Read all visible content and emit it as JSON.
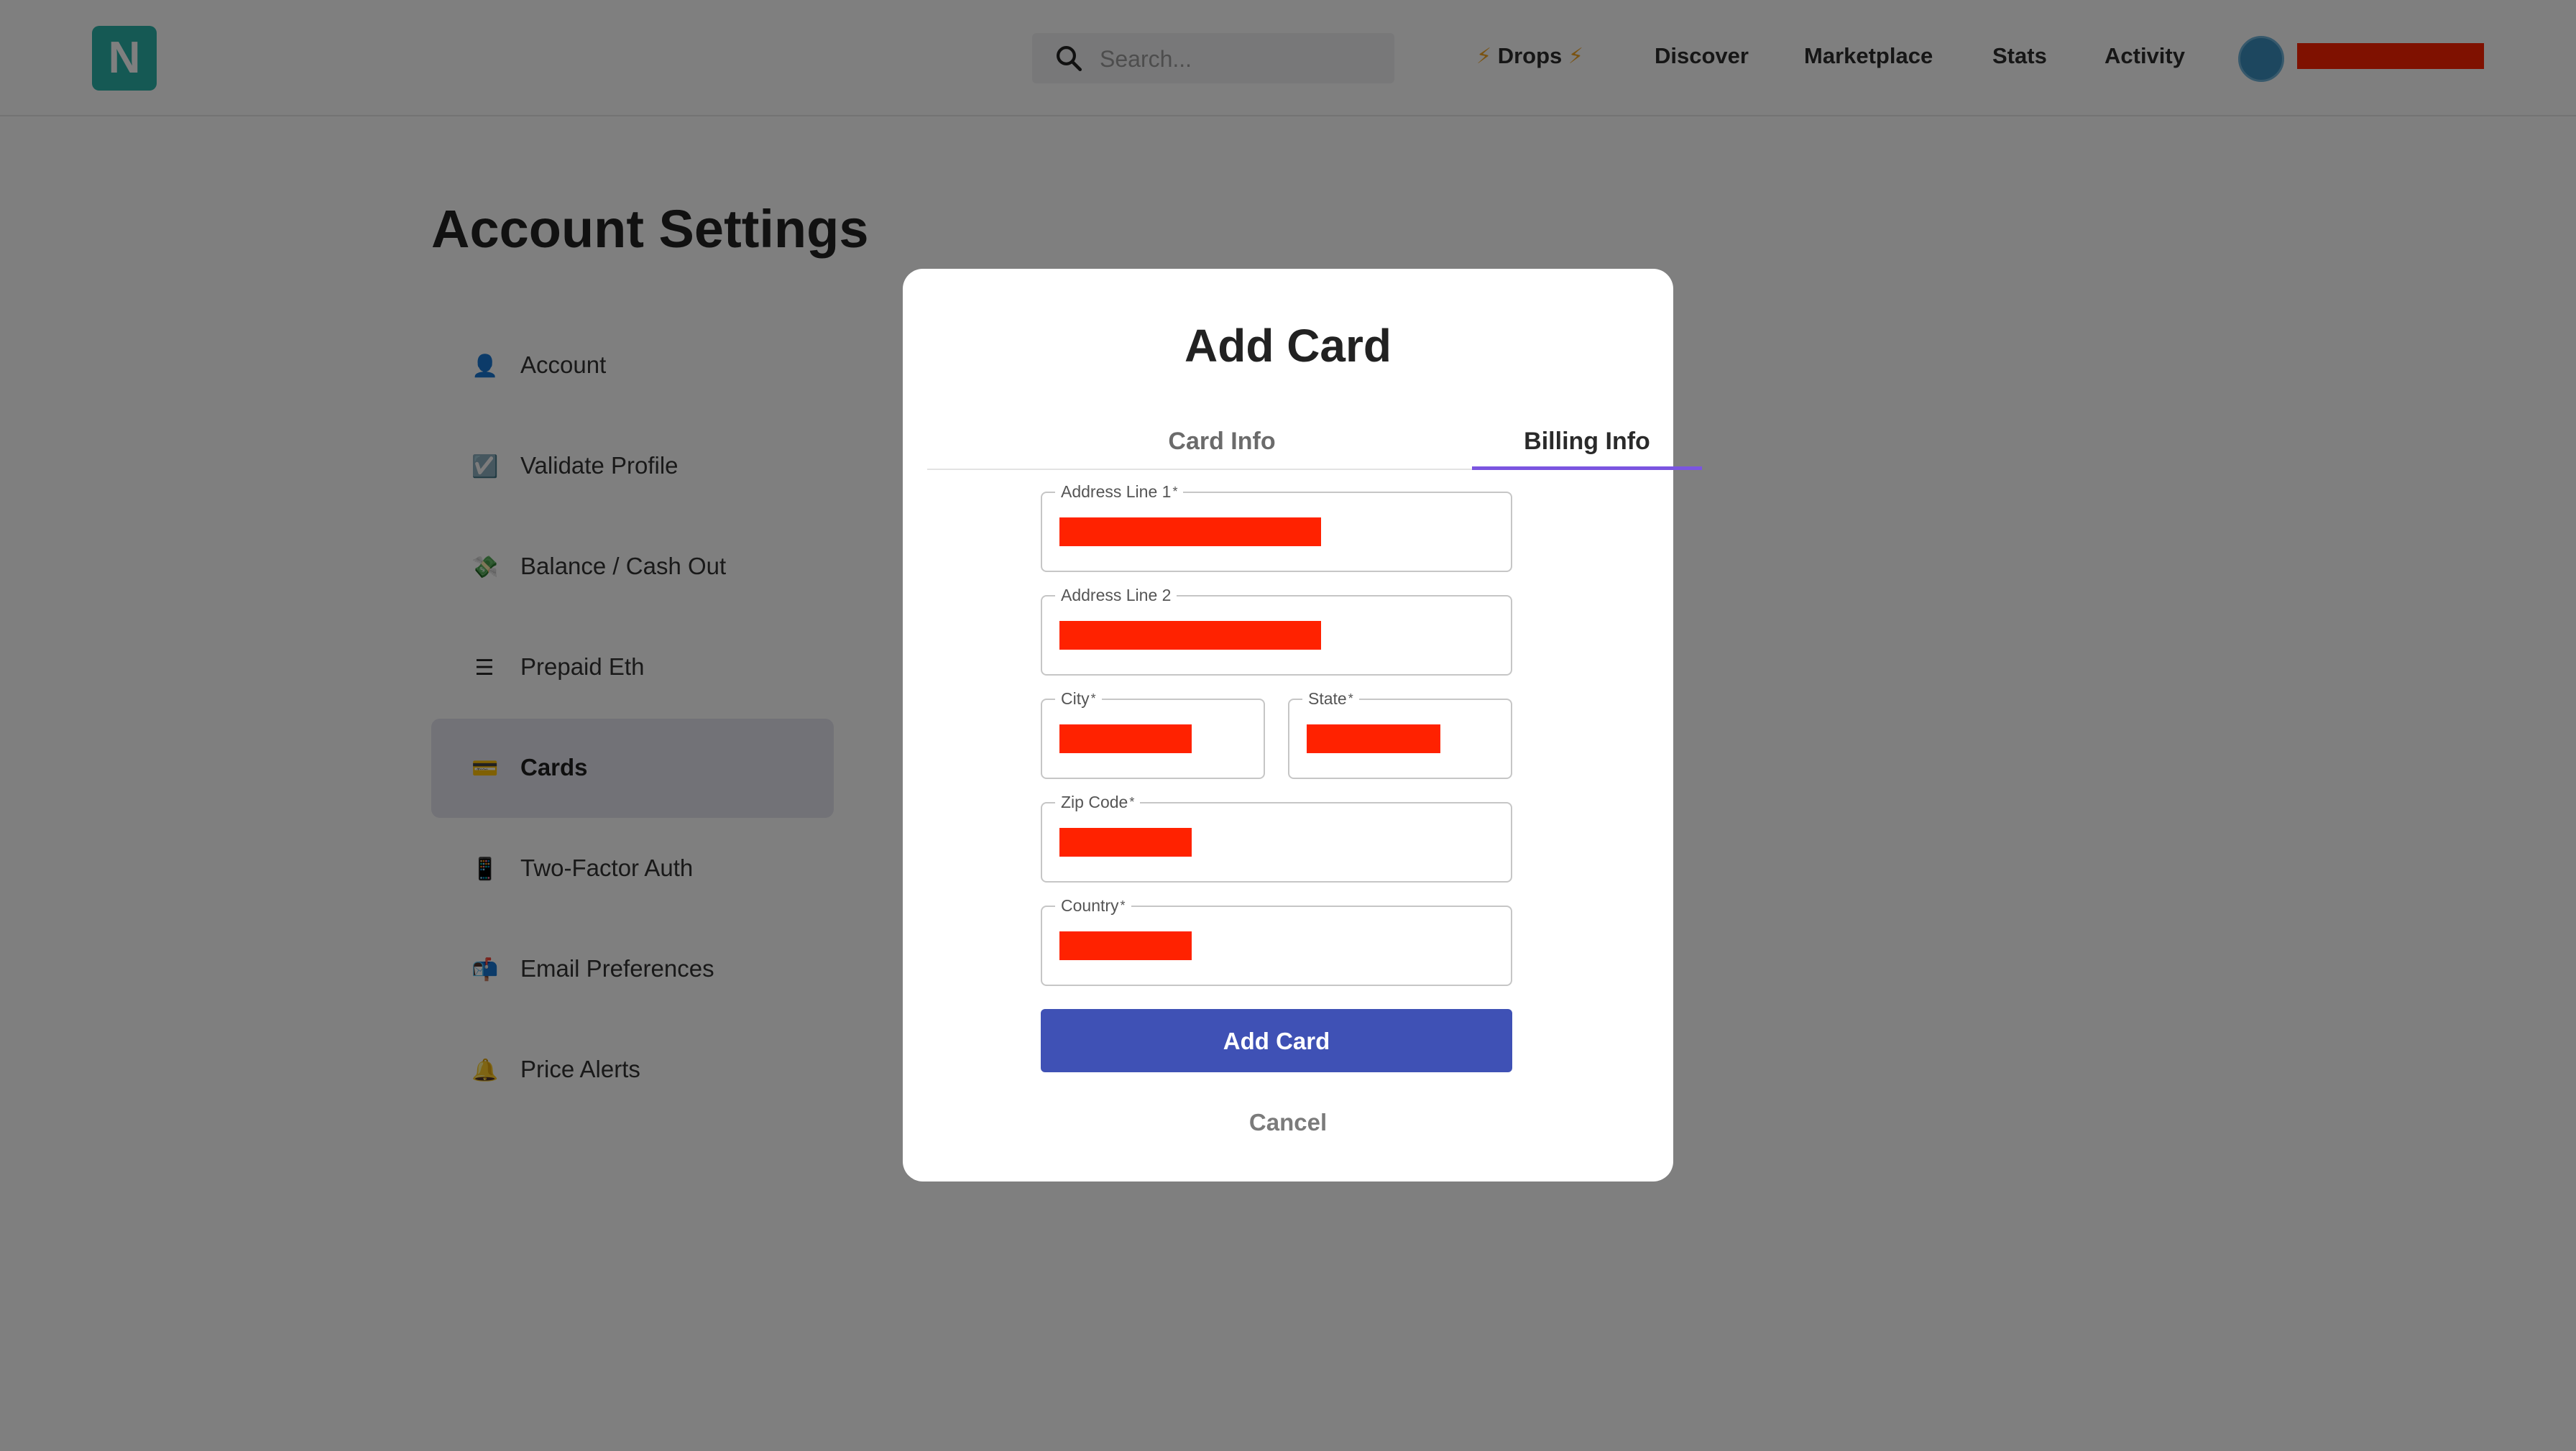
{
  "nav": {
    "logo_letter": "N",
    "search_placeholder": "Search...",
    "links": {
      "drops": "Drops",
      "bolt": "⚡",
      "discover": "Discover",
      "marketplace": "Marketplace",
      "stats": "Stats",
      "activity": "Activity"
    }
  },
  "page": {
    "title": "Account Settings"
  },
  "sidebar": {
    "items": [
      {
        "label": "Account",
        "icon": "👤"
      },
      {
        "label": "Validate Profile",
        "icon": "☑️"
      },
      {
        "label": "Balance / Cash Out",
        "icon": "💸"
      },
      {
        "label": "Prepaid Eth",
        "icon": "☰"
      },
      {
        "label": "Cards",
        "icon": "💳",
        "active": true
      },
      {
        "label": "Two-Factor Auth",
        "icon": "📱"
      },
      {
        "label": "Email Preferences",
        "icon": "📬"
      },
      {
        "label": "Price Alerts",
        "icon": "🔔"
      }
    ]
  },
  "modal": {
    "title": "Add Card",
    "tabs": {
      "card_info": "Card Info",
      "billing_info": "Billing Info"
    },
    "active_tab": "Billing Info",
    "fields": {
      "address1": {
        "label": "Address Line 1",
        "required": "*"
      },
      "address2": {
        "label": "Address Line 2"
      },
      "city": {
        "label": "City",
        "required": "*"
      },
      "state": {
        "label": "State",
        "required": "*"
      },
      "zip": {
        "label": "Zip Code",
        "required": "*"
      },
      "country": {
        "label": "Country",
        "required": "*"
      }
    },
    "submit_label": "Add Card",
    "cancel_label": "Cancel"
  },
  "colors": {
    "accent": "#3f51b5",
    "tab_indicator": "#7b55e0",
    "logo": "#2bb3a8",
    "redaction": "#ff2200"
  }
}
